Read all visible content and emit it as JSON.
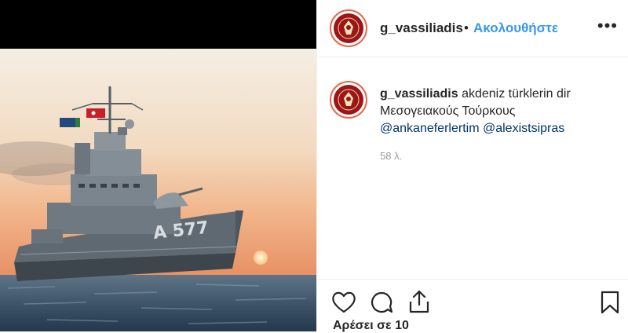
{
  "post": {
    "username": "g_vassiliadis",
    "follow_separator": "•",
    "follow_label": "Ακολουθήστε",
    "more_label": "•••",
    "caption_text": "akdeniz türklerin dir Μεσογειακούς Τούρκους",
    "mentions": [
      "@ankaneferlertim",
      "@alexistsipras"
    ],
    "time_ago": "58 λ.",
    "likes_text": "Αρέσει σε 10",
    "ship_number": "A 577"
  },
  "icons": {
    "like": "heart-icon",
    "comment": "comment-icon",
    "share": "share-icon",
    "save": "bookmark-icon",
    "avatar": "avatar-emblem"
  },
  "colors": {
    "follow": "#3897f0",
    "mention": "#003569",
    "timestamp": "#999999",
    "border": "#efefef",
    "avatar_ring": "#e56a4a",
    "avatar_fill": "#9c1619"
  }
}
